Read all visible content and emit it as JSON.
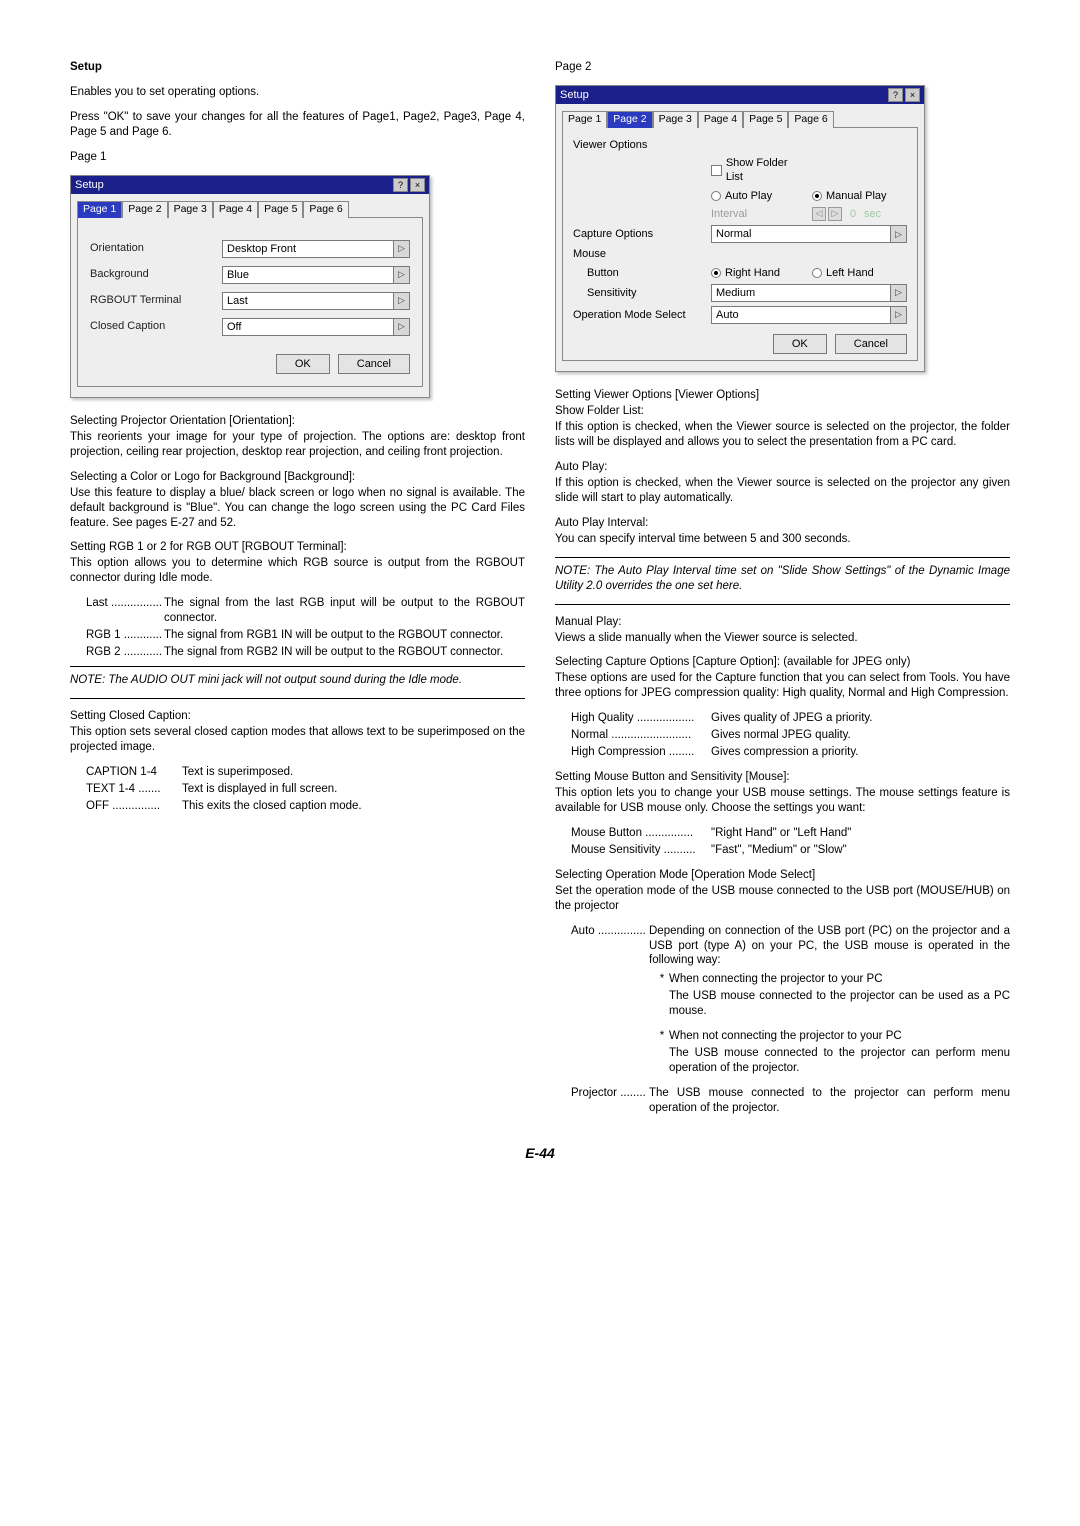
{
  "footer": "E-44",
  "setup": {
    "heading": "Setup",
    "desc1": "Enables you to set operating options.",
    "desc2": "Press \"OK\" to save your changes for all the features of Page1, Page2, Page3, Page 4, Page 5 and Page 6."
  },
  "page1": {
    "label": "Page 1",
    "dialog_title": "Setup",
    "help_btn": "?",
    "close_btn": "×",
    "tabs": [
      "Page 1",
      "Page 2",
      "Page 3",
      "Page 4",
      "Page 5",
      "Page 6"
    ],
    "active_tab": 0,
    "rows": {
      "orientation": {
        "label": "Orientation",
        "value": "Desktop Front"
      },
      "background": {
        "label": "Background",
        "value": "Blue"
      },
      "rgbout": {
        "label": "RGBOUT Terminal",
        "value": "Last"
      },
      "caption": {
        "label": "Closed Caption",
        "value": "Off"
      }
    },
    "ok": "OK",
    "cancel": "Cancel"
  },
  "orientation": {
    "title": "Selecting Projector Orientation [Orientation]:",
    "body": "This reorients your image for your type of projection. The options are: desktop front projection, ceiling rear projection, desktop rear projection, and ceiling front projection."
  },
  "background": {
    "title": "Selecting a Color or Logo for Background [Background]:",
    "body": "Use this feature to display a blue/ black screen or logo when no signal is available. The default background is \"Blue\". You can change the logo screen using the PC Card Files feature. See pages E-27 and 52."
  },
  "rgbout": {
    "title": "Setting RGB 1 or 2 for RGB OUT [RGBOUT Terminal]:",
    "body": "This option allows you to determine which RGB source is output from the RGBOUT connector during Idle mode.",
    "defs": [
      {
        "term": "Last",
        "def": "The signal from the last RGB input will be output to the RGBOUT connector."
      },
      {
        "term": "RGB 1",
        "def": "The signal from RGB1 IN will be output to the RGBOUT connector."
      },
      {
        "term": "RGB 2",
        "def": "The signal from RGB2 IN will be output to the RGBOUT connector."
      }
    ],
    "note": "NOTE: The AUDIO OUT mini jack will not output sound during the Idle mode."
  },
  "caption": {
    "title": "Setting Closed Caption:",
    "body": "This option sets several closed caption modes that allows text to be superimposed on the projected image.",
    "defs": [
      {
        "term": "CAPTION 1-4",
        "def": "Text is superimposed."
      },
      {
        "term": "TEXT 1-4",
        "def": "Text is displayed in full screen."
      },
      {
        "term": "OFF",
        "def": "This exits the closed caption mode."
      }
    ]
  },
  "page2": {
    "label": "Page 2",
    "dialog_title": "Setup",
    "help_btn": "?",
    "close_btn": "×",
    "tabs": [
      "Page 1",
      "Page 2",
      "Page 3",
      "Page 4",
      "Page 5",
      "Page 6"
    ],
    "active_tab": 1,
    "viewer_label": "Viewer Options",
    "show_folder": "Show Folder List",
    "auto_play": "Auto Play",
    "manual_play": "Manual Play",
    "interval_label": "Interval",
    "interval_value": "0",
    "interval_unit": "sec",
    "capture_label": "Capture Options",
    "capture_value": "Normal",
    "mouse_label": "Mouse",
    "button_label": "Button",
    "right_hand": "Right Hand",
    "left_hand": "Left Hand",
    "sensitivity_label": "Sensitivity",
    "sensitivity_value": "Medium",
    "opmode_label": "Operation Mode Select",
    "opmode_value": "Auto",
    "ok": "OK",
    "cancel": "Cancel"
  },
  "viewer": {
    "title": "Setting Viewer Options [Viewer Options]",
    "show_folder_title": "Show Folder List:",
    "show_folder_body": "If this option is checked, when the Viewer source is selected on the projector, the folder lists will be displayed and allows you to select the presentation from a PC card.",
    "auto_play_title": "Auto Play:",
    "auto_play_body": "If this option is checked, when the Viewer source is selected on the projector any given slide will start to play automatically.",
    "auto_play_int_title": "Auto Play Interval:",
    "auto_play_int_body": "You can specify interval time between 5 and 300 seconds.",
    "auto_play_note": "NOTE: The Auto Play Interval time set on \"Slide Show Settings\" of the Dynamic Image Utility 2.0 overrides the one set here.",
    "manual_title": "Manual Play:",
    "manual_body": "Views a slide manually when the Viewer source is selected."
  },
  "capture": {
    "title": "Selecting Capture Options [Capture Option]: (available for JPEG only)",
    "body": "These options are used for the Capture function that you can select from Tools. You have three options for JPEG compression quality: High quality, Normal and High Compression.",
    "defs": [
      {
        "term": "High Quality",
        "def": "Gives quality of JPEG a priority."
      },
      {
        "term": "Normal",
        "def": "Gives normal JPEG quality."
      },
      {
        "term": "High Compression",
        "def": "Gives compression a priority."
      }
    ]
  },
  "mouse": {
    "title": "Setting Mouse Button and Sensitivity [Mouse]:",
    "body": "This option lets you to change your USB mouse settings. The mouse settings feature is available for USB mouse only. Choose the settings you want:",
    "defs": [
      {
        "term": "Mouse Button",
        "def": "\"Right Hand\" or \"Left Hand\""
      },
      {
        "term": "Mouse Sensitivity",
        "def": "\"Fast\", \"Medium\" or \"Slow\""
      }
    ]
  },
  "opmode": {
    "title": "Selecting Operation Mode [Operation Mode Select]",
    "body": "Set the operation mode of the USB mouse connected to the USB port (MOUSE/HUB) on the projector",
    "auto_term": "Auto",
    "auto_def": "Depending on connection of the USB port (PC) on the projector and a USB port (type A) on your PC, the USB mouse is operated in the following way:",
    "auto_b1_h": "When connecting the projector to your PC",
    "auto_b1_b": "The USB mouse connected to the projector can be used as a PC mouse.",
    "auto_b2_h": "When not connecting the projector to your PC",
    "auto_b2_b": "The USB mouse connected to the projector can perform menu operation of the projector.",
    "proj_term": "Projector",
    "proj_def": "The USB mouse connected to the projector can perform menu operation of the projector."
  }
}
